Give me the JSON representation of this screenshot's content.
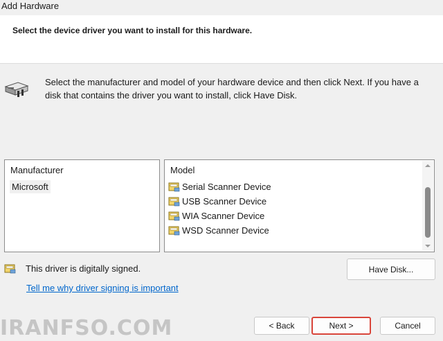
{
  "window": {
    "title": "Add Hardware"
  },
  "header": {
    "instruction": "Select the device driver you want to install for this hardware."
  },
  "description": "Select the manufacturer and model of your hardware device and then click Next. If you have a disk that contains the driver you want to install, click Have Disk.",
  "manufacturer_list": {
    "header": "Manufacturer",
    "items": [
      "Microsoft"
    ],
    "selected": "Microsoft"
  },
  "model_list": {
    "header": "Model",
    "items": [
      "Serial Scanner Device",
      "USB Scanner Device",
      "WIA Scanner Device",
      "WSD Scanner Device"
    ]
  },
  "signing": {
    "status": "This driver is digitally signed.",
    "link": "Tell me why driver signing is important"
  },
  "buttons": {
    "have_disk": "Have Disk...",
    "back": "< Back",
    "next": "Next >",
    "cancel": "Cancel"
  },
  "watermark": "IRANFSO.COM",
  "colors": {
    "link": "#0066cc",
    "next_border": "#d9453a",
    "background": "#f0f0f0"
  },
  "icons": {
    "hardware": "scanner-hardware-icon",
    "driver": "driver-package-icon",
    "signed": "signed-driver-icon"
  }
}
